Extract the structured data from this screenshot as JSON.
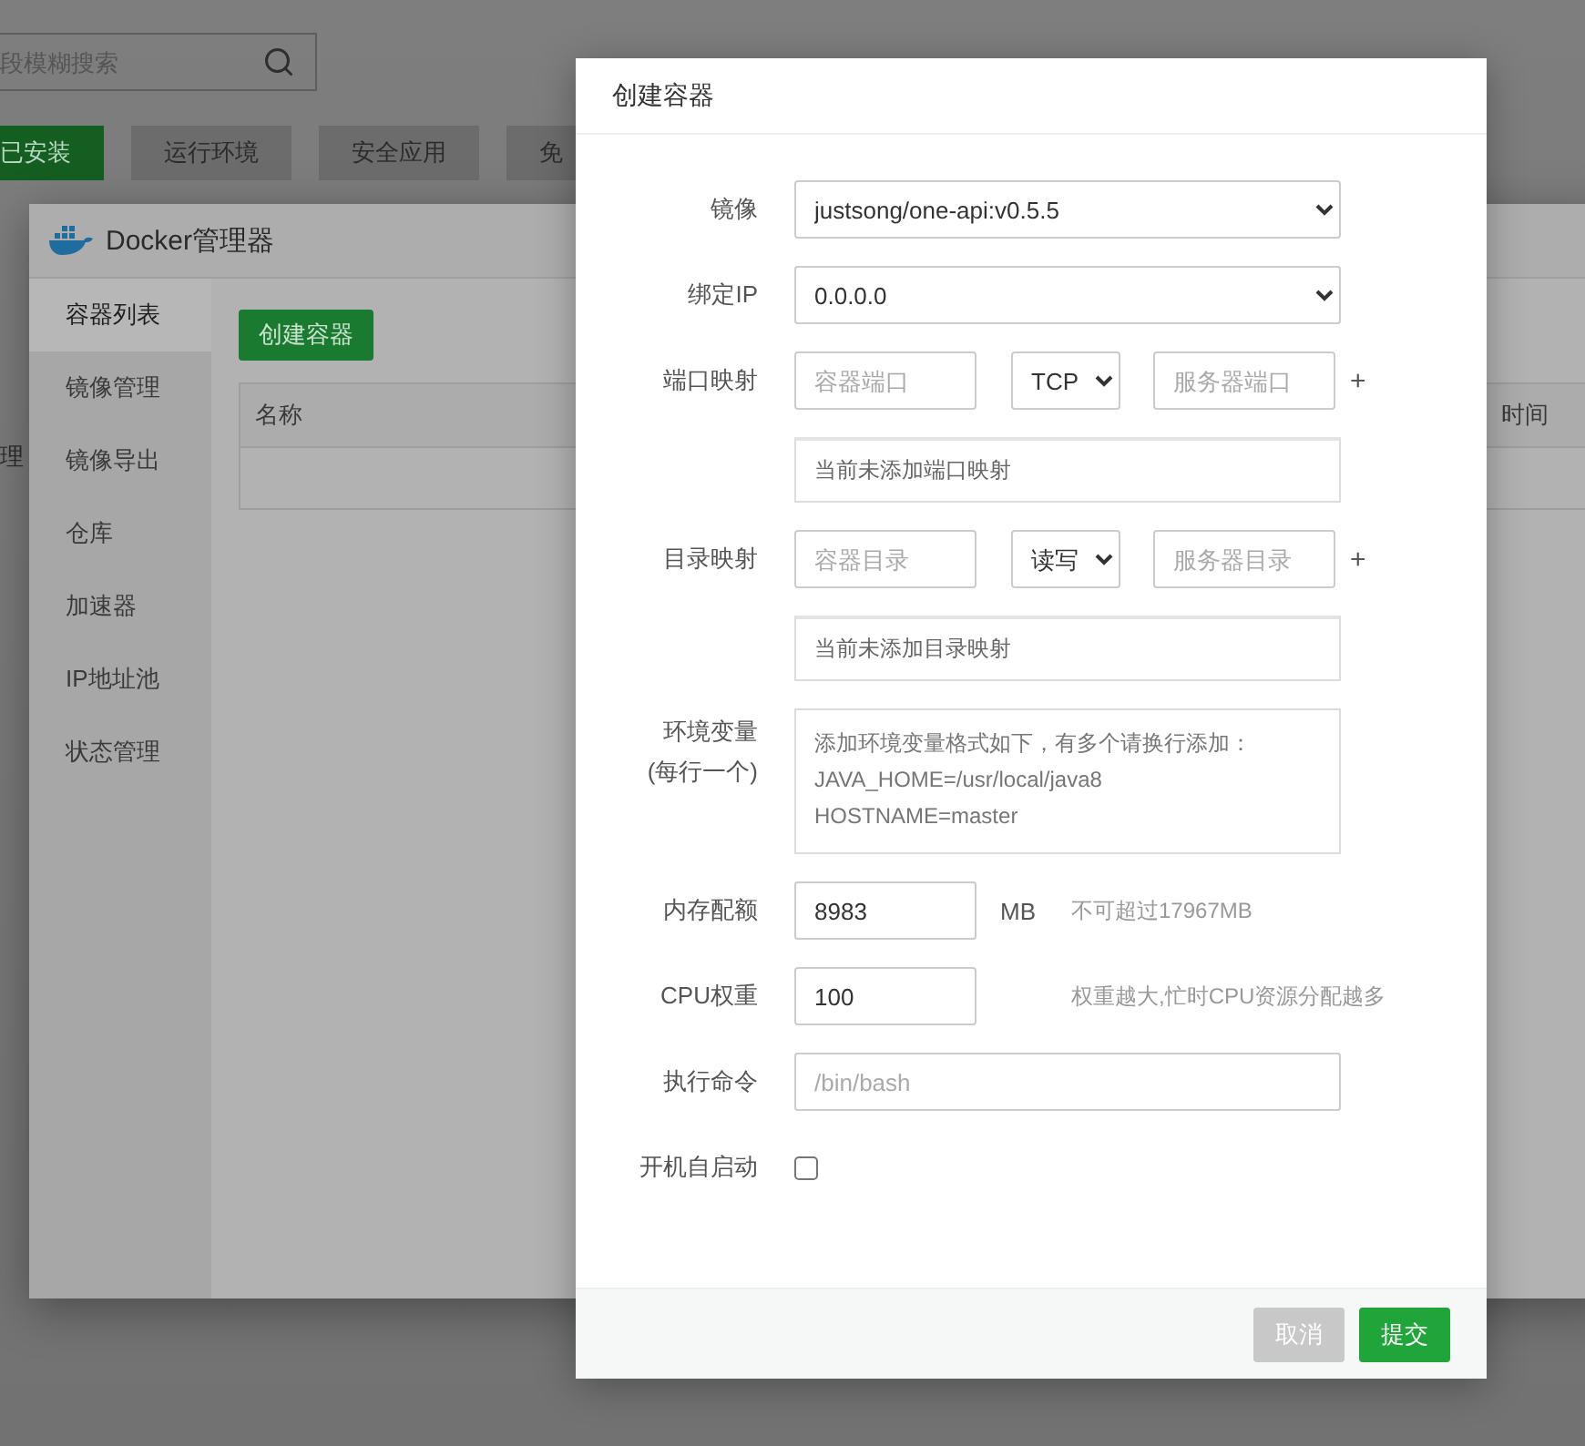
{
  "background": {
    "search": {
      "placeholder": "段模糊搜索"
    },
    "tabs": [
      {
        "label": "已安装",
        "selected": true
      },
      {
        "label": "运行环境",
        "selected": false
      },
      {
        "label": "安全应用",
        "selected": false
      },
      {
        "label": "免",
        "selected": false
      }
    ],
    "side_text": "理"
  },
  "docker": {
    "title": "Docker管理器",
    "menu": [
      {
        "label": "容器列表",
        "selected": true
      },
      {
        "label": "镜像管理",
        "selected": false
      },
      {
        "label": "镜像导出",
        "selected": false
      },
      {
        "label": "仓库",
        "selected": false
      },
      {
        "label": "加速器",
        "selected": false
      },
      {
        "label": "IP地址池",
        "selected": false
      },
      {
        "label": "状态管理",
        "selected": false
      }
    ],
    "create_button": "创建容器",
    "table": {
      "columns": [
        "名称",
        "时间"
      ]
    }
  },
  "dialog": {
    "title": "创建容器",
    "fields": [
      {
        "kind": "select",
        "label": "镜像",
        "value": "justsong/one-api:v0.5.5"
      },
      {
        "kind": "select",
        "label": "绑定IP",
        "value": "0.0.0.0"
      },
      {
        "kind": "mapping",
        "label": "端口映射",
        "left_placeholder": "容器端口",
        "mode": "TCP",
        "right_placeholder": "服务器端口",
        "add": "+",
        "empty_text": "当前未添加端口映射"
      },
      {
        "kind": "mapping",
        "label": "目录映射",
        "left_placeholder": "容器目录",
        "mode": "读写",
        "right_placeholder": "服务器目录",
        "add": "+",
        "empty_text": "当前未添加目录映射"
      },
      {
        "kind": "textarea",
        "label": "环境变量",
        "sublabel": "(每行一个)",
        "placeholder": "添加环境变量格式如下，有多个请换行添加：\nJAVA_HOME=/usr/local/java8\nHOSTNAME=master"
      },
      {
        "kind": "number",
        "label": "内存配额",
        "value": "8983",
        "unit": "MB",
        "hint": "不可超过17967MB"
      },
      {
        "kind": "number",
        "label": "CPU权重",
        "value": "100",
        "hint": "权重越大,忙时CPU资源分配越多"
      },
      {
        "kind": "text",
        "label": "执行命令",
        "placeholder": "/bin/bash"
      },
      {
        "kind": "checkbox",
        "label": "开机自启动",
        "checked": false
      }
    ],
    "buttons": [
      {
        "label": "取消",
        "kind": "cancel"
      },
      {
        "label": "提交",
        "kind": "submit"
      }
    ]
  }
}
